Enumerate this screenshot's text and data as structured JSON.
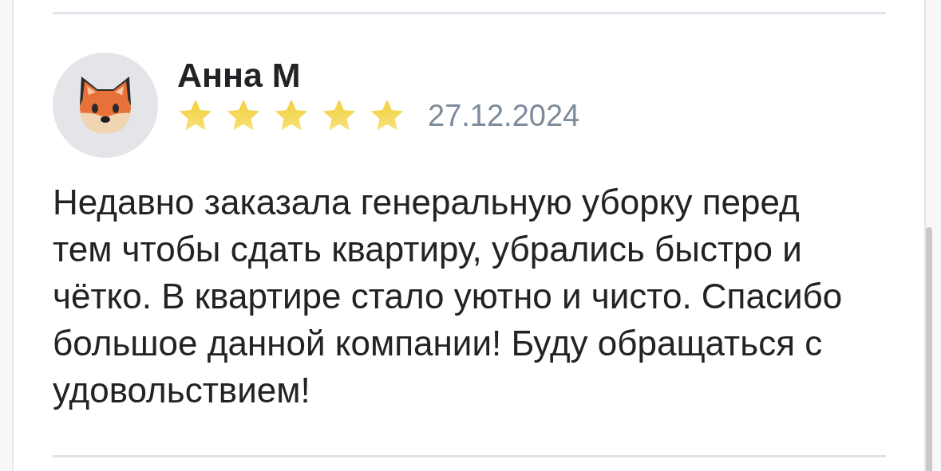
{
  "review": {
    "author": "Анна М",
    "stars": 5,
    "date": "27.12.2024",
    "text": "Недавно заказала генеральную уборку перед тем чтобы сдать квартиру, убрались быстро и чётко. В квартире стало уютно и чисто. Спасибо большое данной компании! Буду обращаться с удовольствием!"
  }
}
